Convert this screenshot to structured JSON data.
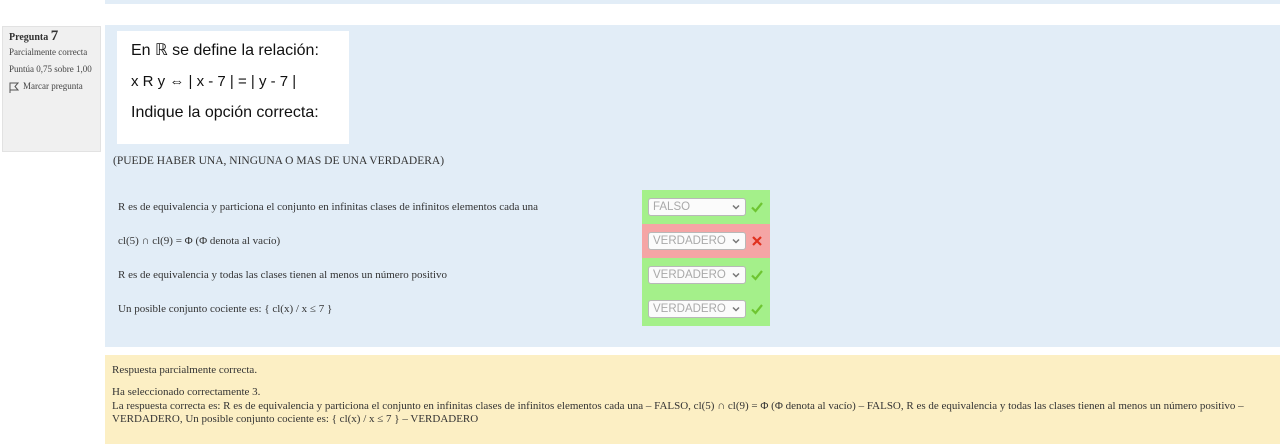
{
  "question_info": {
    "label": "Pregunta",
    "number": "7",
    "state": "Parcialmente correcta",
    "grade": "Puntúa 0,75 sobre 1,00",
    "flag_label": "Marcar pregunta"
  },
  "stem": {
    "line1": "En ℝ se define la relación:",
    "line2": "x R y ⇔ | x - 7 | = | y - 7 |",
    "line3": "Indique la opción correcta:"
  },
  "note": "(PUEDE HABER UNA, NINGUNA O MAS DE UNA VERDADERA)",
  "answers": [
    {
      "text": "R es de equivalencia y particiona el conjunto en infinitas clases de infinitos elementos cada una",
      "selected": "FALSO",
      "status": "correct"
    },
    {
      "text": "cl(5) ∩ cl(9) = Φ  (Φ denota al vacío)",
      "selected": "VERDADERO",
      "status": "incorrect"
    },
    {
      "text": "R es de equivalencia y todas las clases tienen al menos un número positivo",
      "selected": "VERDADERO",
      "status": "correct"
    },
    {
      "text": "Un posible conjunto cociente es:  { cl(x) / x ≤ 7 }",
      "selected": "VERDADERO",
      "status": "correct"
    }
  ],
  "feedback": {
    "line1": "Respuesta parcialmente correcta.",
    "line2": "Ha seleccionado correctamente 3.",
    "line3": "La respuesta correcta es: R es de equivalencia y particiona el conjunto en infinitas clases de infinitos elementos cada una – FALSO, cl(5) ∩ cl(9) = Φ  (Φ denota al vacío) – FALSO, R es de equivalencia y todas las clases tienen al menos un número positivo – VERDADERO, Un posible conjunto cociente es:  { cl(x) / x ≤ 7 } – VERDADERO"
  },
  "colors": {
    "formulation_bg": "#e2edf7",
    "correct_bg": "#a4f08a",
    "incorrect_bg": "#f5a5a5",
    "feedback_bg": "#fcefc4",
    "check_color": "#6ec531",
    "cross_color": "#e0301e"
  },
  "icons": {
    "flag": "flag-icon",
    "correct": "check-icon",
    "incorrect": "cross-icon",
    "dropdown": "chevron-down-icon"
  }
}
